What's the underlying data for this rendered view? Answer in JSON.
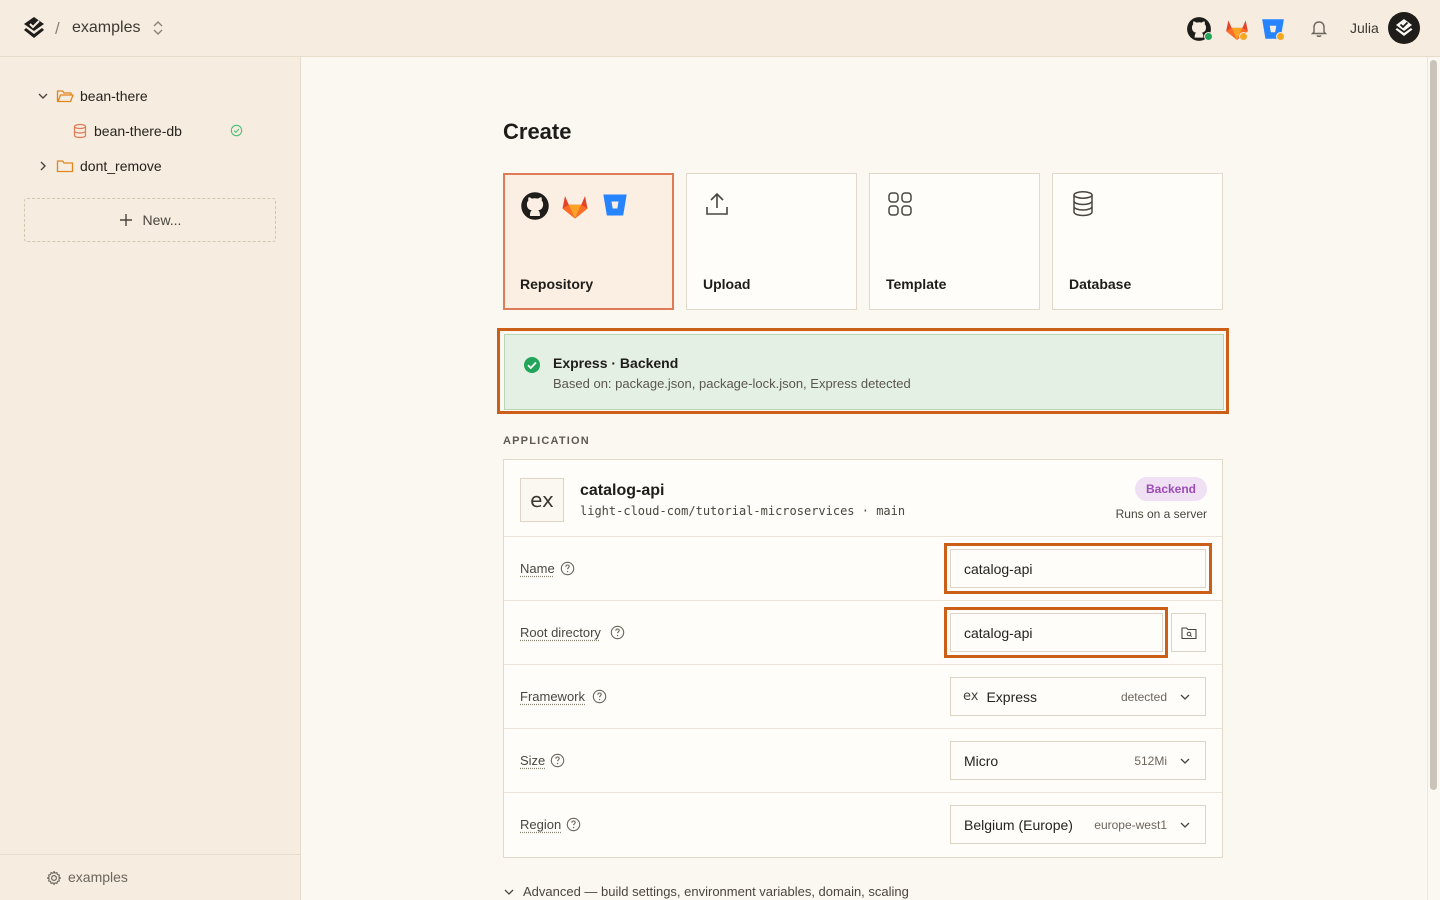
{
  "topbar": {
    "separator": "/",
    "project": "examples",
    "user": "Julia"
  },
  "sidebar": {
    "tree": [
      {
        "label": "bean-there",
        "type": "folder",
        "expanded": true
      },
      {
        "label": "bean-there-db",
        "type": "database",
        "status": "healthy"
      },
      {
        "label": "dont_remove",
        "type": "folder",
        "expanded": false
      }
    ],
    "new_label": "New...",
    "footer_label": "examples"
  },
  "main": {
    "title": "Create",
    "sources": [
      {
        "label": "Repository",
        "icons": [
          "github-icon",
          "gitlab-icon",
          "bitbucket-icon"
        ],
        "selected": true
      },
      {
        "label": "Upload",
        "icons": [
          "upload-icon"
        ],
        "selected": false
      },
      {
        "label": "Template",
        "icons": [
          "template-grid-icon"
        ],
        "selected": false
      },
      {
        "label": "Database",
        "icons": [
          "database-icon"
        ],
        "selected": false
      }
    ],
    "detection": {
      "title": "Express · Backend",
      "subtitle": "Based on: package.json, package-lock.json, Express detected"
    },
    "section_label": "APPLICATION",
    "app": {
      "logo_text": "ex",
      "name": "catalog-api",
      "repo": "light-cloud-com/tutorial-microservices · main",
      "badge": "Backend",
      "runs": "Runs on a server"
    },
    "fields": {
      "name": {
        "label": "Name",
        "value": "catalog-api"
      },
      "root": {
        "label": "Root directory",
        "value": "catalog-api"
      },
      "framework": {
        "label": "Framework",
        "prefix": "ex",
        "value": "Express",
        "meta": "detected"
      },
      "size": {
        "label": "Size",
        "value": "Micro",
        "meta": "512Mi"
      },
      "region": {
        "label": "Region",
        "value": "Belgium (Europe)",
        "meta": "europe-west1"
      }
    },
    "advanced": "Advanced — build settings, environment variables, domain, scaling"
  },
  "colors": {
    "accent": "#cc5f18",
    "selected_card_border": "#e07b57",
    "detection_bg": "#e4f0e3",
    "success": "#22a55a",
    "badge_bg": "#efe0f4",
    "badge_text": "#9b4bb5"
  }
}
